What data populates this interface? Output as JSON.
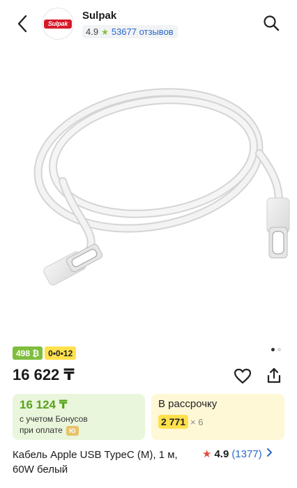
{
  "header": {
    "shop_name": "Sulpak",
    "logo_text": "Sulpak",
    "rating": "4.9",
    "reviews": "53677 отзывов"
  },
  "badges": {
    "green": "498 ₿",
    "yellow": "0•0•12"
  },
  "product": {
    "price": "16 622 ₸",
    "title": "Кабель Apple USB TypeC (M), 1 м, 60W белый",
    "rating": "4.9",
    "rating_count": "(1377)"
  },
  "bonus_card": {
    "price": "16 124 ₸",
    "note_line1": "с учетом Бонусов",
    "note_line2": "при оплате",
    "chip": "Ю"
  },
  "installment_card": {
    "title": "В рассрочку",
    "amount": "2 771",
    "times": "× 6"
  },
  "gallery": {
    "slide_count": 2,
    "active_index": 0
  },
  "colors": {
    "brand_red": "#d7192a",
    "green": "#7fbe3d",
    "yellow": "#ffe14d",
    "link_blue": "#2a68c9"
  },
  "icons": {
    "back": "chevron-left-icon",
    "search": "search-icon",
    "favorite": "heart-icon",
    "share": "share-icon",
    "star": "star-icon"
  }
}
